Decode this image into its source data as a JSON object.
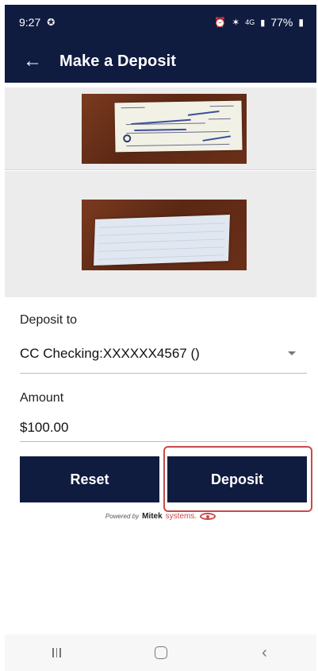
{
  "status_bar": {
    "time": "9:27",
    "battery": "77%",
    "network": "4G"
  },
  "app_bar": {
    "title": "Make a Deposit",
    "back_icon": "arrow-left-icon"
  },
  "deposit": {
    "label": "Deposit to",
    "account": "CC Checking:XXXXXX4567 ()"
  },
  "amount": {
    "label": "Amount",
    "value": "$100.00"
  },
  "buttons": {
    "reset": "Reset",
    "deposit": "Deposit"
  },
  "powered_by": {
    "prefix": "Powered by",
    "brand": "Mitek",
    "suffix": "systems."
  },
  "colors": {
    "primary": "#0f1b3f",
    "highlight": "#c94a4a"
  }
}
